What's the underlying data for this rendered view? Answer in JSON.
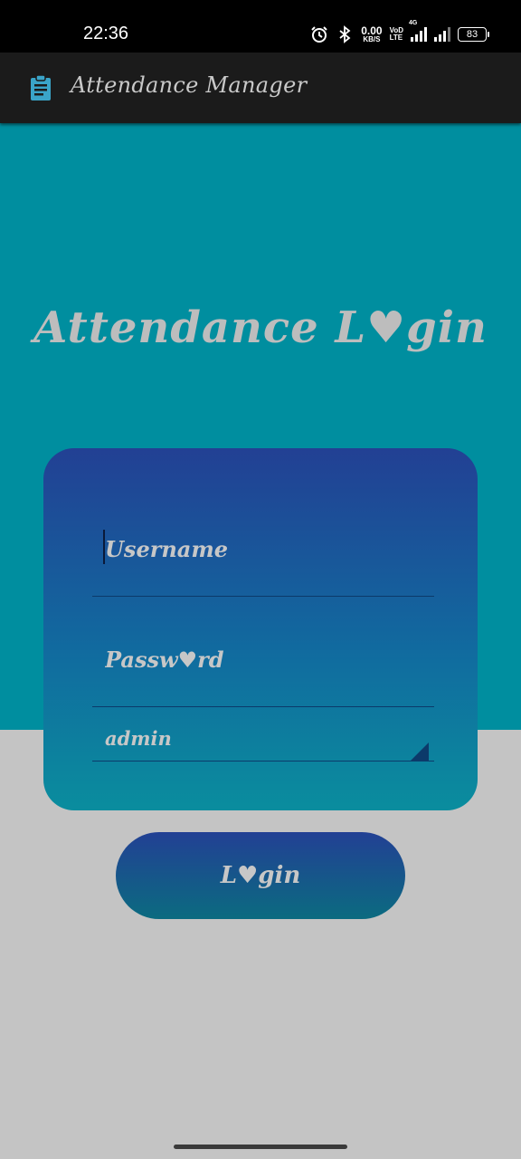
{
  "status_bar": {
    "time": "22:36",
    "net_speed_value": "0.00",
    "net_speed_unit": "KB/S",
    "volte_top": "VoD",
    "volte_bottom": "LTE",
    "network_type": "4G",
    "battery_level": "83",
    "icons": [
      "alarm-icon",
      "bluetooth-icon",
      "signal-icon",
      "signal-icon",
      "battery-icon"
    ]
  },
  "app_bar": {
    "icon": "clipboard-icon",
    "title": "Attendance Manager"
  },
  "login": {
    "heading": "Attendance  L♥gin",
    "username_placeholder": "Username",
    "password_placeholder": "Passw♥rd",
    "role_value": "admin",
    "button_label": "L♥gin"
  },
  "colors": {
    "status_bar": "#000000",
    "app_bar": "#1b1b1b",
    "hero": "#008e9f",
    "background": "#c4c4c4",
    "card_top": "#224094",
    "card_bottom": "#0a8d9e",
    "text": "#c7c7c7",
    "icon_accent": "#3aa4c8"
  }
}
